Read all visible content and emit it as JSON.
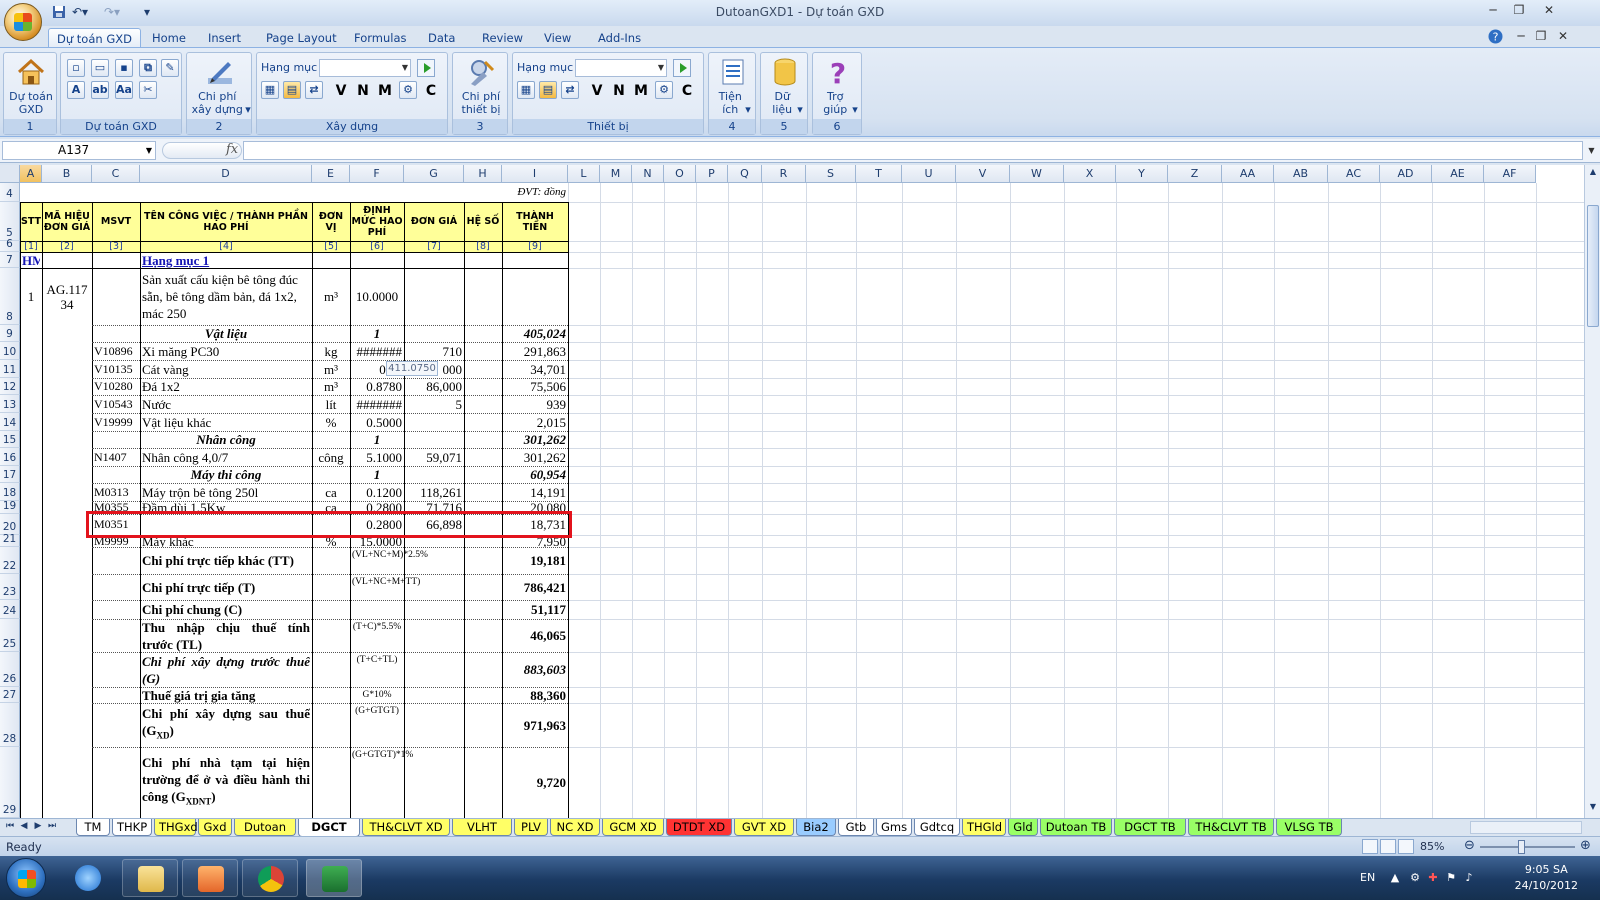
{
  "window": {
    "title": "DutoanGXD1 - Dự toán GXD"
  },
  "ribbon_tabs": [
    "Dự toán GXD",
    "Home",
    "Insert",
    "Page Layout",
    "Formulas",
    "Data",
    "Review",
    "View",
    "Add-Ins"
  ],
  "ribbon": {
    "dutoan_btn": "Dự toán GXD",
    "group1_label": "1",
    "group_dutoan_label": "Dự toán GXD",
    "chiphi_btn": "Chi phí xây dựng",
    "group2_label": "2",
    "hangmuc_label": "Hạng mục",
    "group_xaydung_label": "Xây dựng",
    "chiphi_tb_btn": "Chi phí thiết bị",
    "group3_label": "3",
    "hangmuc_label2": "Hạng mục",
    "group_thietbi_label": "Thiết bị",
    "tienich_btn": "Tiện ích",
    "group4_label": "4",
    "dulieu_btn": "Dữ liệu",
    "group5_label": "5",
    "trogiup_btn": "Trợ giúp",
    "group6_label": "6",
    "letters": [
      "V",
      "N",
      "M",
      "C"
    ]
  },
  "formula_bar": {
    "name_box": "A137",
    "fx": "fx",
    "formula": ""
  },
  "columns": [
    "A",
    "B",
    "C",
    "D",
    "E",
    "F",
    "G",
    "H",
    "I",
    "L",
    "M",
    "N",
    "O",
    "P",
    "Q",
    "R",
    "S",
    "T",
    "U",
    "V",
    "W",
    "X",
    "Y",
    "Z",
    "AA",
    "AB",
    "AC",
    "AD",
    "AE",
    "AF"
  ],
  "row_numbers": [
    "4",
    "5",
    "6",
    "7",
    "8",
    "9",
    "10",
    "11",
    "12",
    "13",
    "14",
    "15",
    "16",
    "17",
    "18",
    "19",
    "20",
    "21",
    "22",
    "23",
    "24",
    "25",
    "26",
    "27",
    "28",
    "29"
  ],
  "sheet": {
    "unit_note": "ĐVT: đồng",
    "headers": {
      "stt": "STT",
      "mahieu": "MÃ HIỆU ĐƠN GIÁ",
      "msvt": "MSVT",
      "ten": "TÊN CÔNG VIỆC / THÀNH PHẦN HAO PHÍ",
      "donvi": "ĐƠN VỊ",
      "dinhmuc": "ĐỊNH MỨC HAO PHÍ",
      "dongia": "ĐƠN GIÁ",
      "heso": "HỆ SỐ",
      "thanhtien": "THÀNH TIỀN"
    },
    "indices": [
      "[1]",
      "[2]",
      "[3]",
      "[4]",
      "[5]",
      "[6]",
      "[7]",
      "[8]",
      "[9]"
    ],
    "hm_code": "HM",
    "hm_name": "Hạng mục 1",
    "work": {
      "stt": "1",
      "code": "AG.11734",
      "name": "Sản xuất cấu kiện bê tông đúc sẵn, bê tông dầm bản, đá 1x2, mác 250",
      "unit": "m³",
      "qty": "10.0000"
    },
    "vatlieu": {
      "label": "Vật liệu",
      "factor": "1",
      "total": "405,024"
    },
    "materials": [
      {
        "code": "V10896",
        "name": "Xi măng PC30",
        "unit": "kg",
        "norm": "#######",
        "price": "710",
        "amount": "291,863"
      },
      {
        "code": "V10135",
        "name": "Cát vàng",
        "unit": "m³",
        "norm": "0.45",
        "price": "000",
        "amount": "34,701"
      },
      {
        "code": "V10280",
        "name": "Đá 1x2",
        "unit": "m³",
        "norm": "0.8780",
        "price": "86,000",
        "amount": "75,506"
      },
      {
        "code": "V10543",
        "name": "Nước",
        "unit": "lít",
        "norm": "#######",
        "price": "5",
        "amount": "939"
      },
      {
        "code": "V19999",
        "name": "Vật liệu khác",
        "unit": "%",
        "norm": "0.5000",
        "price": "",
        "amount": "2,015"
      }
    ],
    "tooltip_value": "411.0750",
    "nhancong": {
      "label": "Nhân công",
      "factor": "1",
      "total": "301,262"
    },
    "labor": {
      "code": "N1407",
      "name": "Nhân công 4,0/7",
      "unit": "công",
      "norm": "5.1000",
      "price": "59,071",
      "amount": "301,262"
    },
    "maythicong": {
      "label": "Máy thi công",
      "factor": "1",
      "total": "60,954"
    },
    "machines": [
      {
        "code": "M0313",
        "name": "Máy trộn bê tông 250l",
        "unit": "ca",
        "norm": "0.1200",
        "price": "118,261",
        "amount": "14,191"
      },
      {
        "code": "M0355",
        "name": "Đầm dùi 1,5Kw",
        "unit": "ca",
        "norm": "0.2800",
        "price": "71,716",
        "amount": "20,080"
      },
      {
        "code": "M0351",
        "name": "",
        "unit": "",
        "norm": "0.2800",
        "price": "66,898",
        "amount": "18,731"
      },
      {
        "code": "M9999",
        "name": "Máy khác",
        "unit": "%",
        "norm": "15.0000",
        "price": "",
        "amount": "7,950"
      }
    ],
    "summary": [
      {
        "name": "Chi phí trực tiếp khác (TT)",
        "formula": "(VL+NC+M)*2.5%",
        "amount": "19,181",
        "italic": false
      },
      {
        "name": "Chi phí trực tiếp (T)",
        "formula": "(VL+NC+M+TT)",
        "amount": "786,421",
        "italic": false
      },
      {
        "name": "Chi phí chung (C)",
        "formula": "",
        "amount": "51,117",
        "italic": false
      },
      {
        "name": "Thu nhập chịu thuế tính trước (TL)",
        "formula": "(T+C)*5.5%",
        "amount": "46,065",
        "italic": false
      },
      {
        "name": "Chi phí xây dựng trước thuế (G)",
        "formula": "(T+C+TL)",
        "amount": "883,603",
        "italic": true
      },
      {
        "name": "Thuế giá trị gia tăng",
        "formula": "G*10%",
        "amount": "88,360",
        "italic": false
      },
      {
        "name": "Chi phí xây dựng sau thuế (G",
        "sub": "XD",
        "name_end": ")",
        "formula": "(G+GTGT)",
        "amount": "971,963",
        "italic": false
      },
      {
        "name": "Chi phí nhà tạm tại hiện trường để ở và điều hành thi công (G",
        "sub": "XDNT",
        "name_end": ")",
        "formula": "(G+GTGT)*1%",
        "amount": "9,720",
        "italic": false
      }
    ]
  },
  "sheet_tabs": [
    {
      "label": "TM",
      "color": "#ffffff"
    },
    {
      "label": "THKP",
      "color": "#ffffff"
    },
    {
      "label": "THGxd",
      "color": "#ffff66"
    },
    {
      "label": "Gxd",
      "color": "#ffff66"
    },
    {
      "label": "Dutoan XD",
      "color": "#ffff66"
    },
    {
      "label": "DGCT XD",
      "color": "#ffffff"
    },
    {
      "label": "TH&CLVT XD",
      "color": "#ffff66"
    },
    {
      "label": "VLHT XD",
      "color": "#ffff66"
    },
    {
      "label": "PLV",
      "color": "#ffff66"
    },
    {
      "label": "NC XD",
      "color": "#ffff66"
    },
    {
      "label": "GCM XD",
      "color": "#ffff66"
    },
    {
      "label": "DTDT XD",
      "color": "#ff3333"
    },
    {
      "label": "GVT XD",
      "color": "#ffff66"
    },
    {
      "label": "Bia2",
      "color": "#99ccff"
    },
    {
      "label": "Gtb",
      "color": "#ffffff"
    },
    {
      "label": "Gms",
      "color": "#ffffff"
    },
    {
      "label": "Gdtcq",
      "color": "#ffffff"
    },
    {
      "label": "THGld",
      "color": "#ffff66"
    },
    {
      "label": "Gld",
      "color": "#99ff66"
    },
    {
      "label": "Dutoan TB",
      "color": "#99ff66"
    },
    {
      "label": "DGCT TB",
      "color": "#99ff66"
    },
    {
      "label": "TH&CLVT TB",
      "color": "#99ff66"
    },
    {
      "label": "VLSG TB",
      "color": "#99ff66"
    }
  ],
  "active_sheet": "DGCT XD",
  "status": {
    "text": "Ready",
    "zoom": "85%"
  },
  "taskbar": {
    "lang": "EN",
    "time": "9:05 SA",
    "date": "24/10/2012"
  }
}
